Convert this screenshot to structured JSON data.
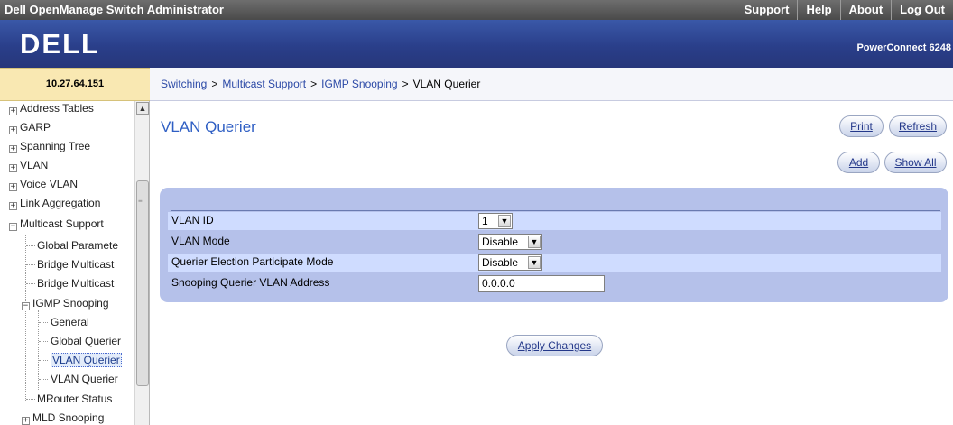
{
  "topbar": {
    "title": "Dell OpenManage Switch Administrator",
    "links": [
      "Support",
      "Help",
      "About",
      "Log Out"
    ]
  },
  "banner": {
    "logo_text": "DELL",
    "model": "PowerConnect 6248"
  },
  "ip": "10.27.64.151",
  "breadcrumb": {
    "items": [
      "Switching",
      "Multicast Support",
      "IGMP Snooping"
    ],
    "separator": ">",
    "current": "VLAN Querier"
  },
  "nav": {
    "items": [
      {
        "label": "Address Tables",
        "toggle": "+"
      },
      {
        "label": "GARP",
        "toggle": "+"
      },
      {
        "label": "Spanning Tree",
        "toggle": "+"
      },
      {
        "label": "VLAN",
        "toggle": "+"
      },
      {
        "label": "Voice VLAN",
        "toggle": "+"
      },
      {
        "label": "Link Aggregation",
        "toggle": "+"
      },
      {
        "label": "Multicast Support",
        "toggle": "−"
      },
      {
        "label": "Global Paramete"
      },
      {
        "label": "Bridge Multicast"
      },
      {
        "label": "Bridge Multicast"
      },
      {
        "label": "IGMP Snooping",
        "toggle": "−"
      },
      {
        "label": "General"
      },
      {
        "label": "Global Querier"
      },
      {
        "label": "VLAN Querier"
      },
      {
        "label": "VLAN Querier"
      },
      {
        "label": "MRouter Status"
      },
      {
        "label": "MLD Snooping",
        "toggle": "+"
      }
    ]
  },
  "page": {
    "title": "VLAN Querier",
    "buttons": {
      "print": "Print",
      "refresh": "Refresh",
      "add": "Add",
      "show_all": "Show All"
    },
    "fields": {
      "vlan_id": {
        "label": "VLAN ID",
        "value": "1"
      },
      "vlan_mode": {
        "label": "VLAN Mode",
        "value": "Disable"
      },
      "querier_election": {
        "label": "Querier Election Participate Mode",
        "value": "Disable"
      },
      "querier_address": {
        "label": "Snooping Querier VLAN Address",
        "value": "0.0.0.0"
      }
    },
    "apply": "Apply Changes"
  },
  "colors": {
    "banner": "#2a3f8a",
    "title_blue": "#2f5fc4",
    "panel": "#b5c1ea",
    "panel_row": "#cfdcff",
    "ip_box": "#f9e8b2"
  }
}
